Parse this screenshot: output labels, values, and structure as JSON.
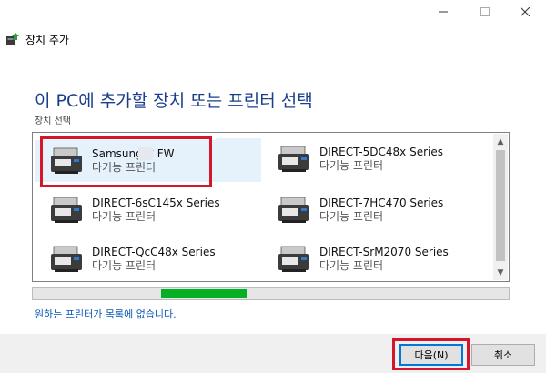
{
  "window": {
    "title": "장치 추가",
    "controls": [
      "minimize",
      "maximize",
      "close"
    ]
  },
  "main": {
    "heading": "이 PC에 추가할 장치 또는 프린터 선택",
    "subheading": "장치 선택"
  },
  "devices": [
    {
      "name": "Samsung C    FW",
      "type": "다기능 프린터",
      "selected": true
    },
    {
      "name": "DIRECT-5DC48x Series",
      "type": "다기능 프린터"
    },
    {
      "name": "DIRECT-6sC145x Series",
      "type": "다기능 프린터"
    },
    {
      "name": "DIRECT-7HC470 Series",
      "type": "다기능 프린터"
    },
    {
      "name": "DIRECT-QcC48x Series",
      "type": "다기능 프린터"
    },
    {
      "name": "DIRECT-SrM2070 Series",
      "type": "다기능 프린터"
    }
  ],
  "search_progress": {
    "indeterminate_segment_start": 0.27,
    "indeterminate_segment_end": 0.45
  },
  "missing_link": "원하는 프린터가 목록에 없습니다.",
  "buttons": {
    "next": "다음(N)",
    "cancel": "취소"
  },
  "colors": {
    "heading": "#1a3e8c",
    "link": "#0a58b6",
    "progress": "#06b025",
    "highlight": "#d3162b",
    "selection": "#e5f1fb"
  },
  "icons": {
    "app": "add-device-icon",
    "device": "printer-icon"
  }
}
